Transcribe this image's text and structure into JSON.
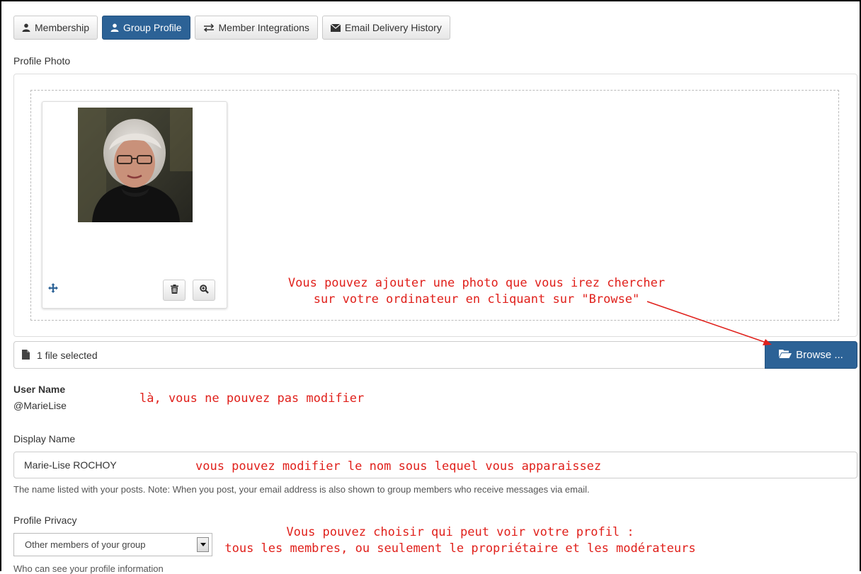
{
  "tabs": [
    {
      "label": "Membership",
      "icon": "user-icon",
      "active": false
    },
    {
      "label": "Group Profile",
      "icon": "user-icon",
      "active": true
    },
    {
      "label": "Member Integrations",
      "icon": "exchange-icon",
      "active": false
    },
    {
      "label": "Email Delivery History",
      "icon": "envelope-icon",
      "active": false
    }
  ],
  "profile_photo": {
    "label": "Profile Photo",
    "file_status": "1 file selected",
    "browse_label": "Browse ..."
  },
  "user_name": {
    "label": "User Name",
    "value": "@MarieLise"
  },
  "display_name": {
    "label": "Display Name",
    "value": "Marie-Lise ROCHOY",
    "help": "The name listed with your posts. Note: When you post, your email address is also shown to group members who receive messages via email."
  },
  "profile_privacy": {
    "label": "Profile Privacy",
    "selected": "Other members of your group",
    "help": "Who can see your profile information"
  },
  "annotations": {
    "photo_line1": "Vous pouvez ajouter une photo que vous irez chercher",
    "photo_line2": "sur votre ordinateur en cliquant sur \"Browse\"",
    "username_note": "là, vous ne pouvez pas modifier",
    "displayname_note": "vous pouvez modifier le nom sous lequel vous apparaissez",
    "privacy_line1": "Vous pouvez choisir qui peut voir votre profil :",
    "privacy_line2": "tous les membres, ou seulement le propriétaire et les modérateurs"
  },
  "colors": {
    "primary": "#2c6296",
    "annotation": "#e0201b"
  }
}
